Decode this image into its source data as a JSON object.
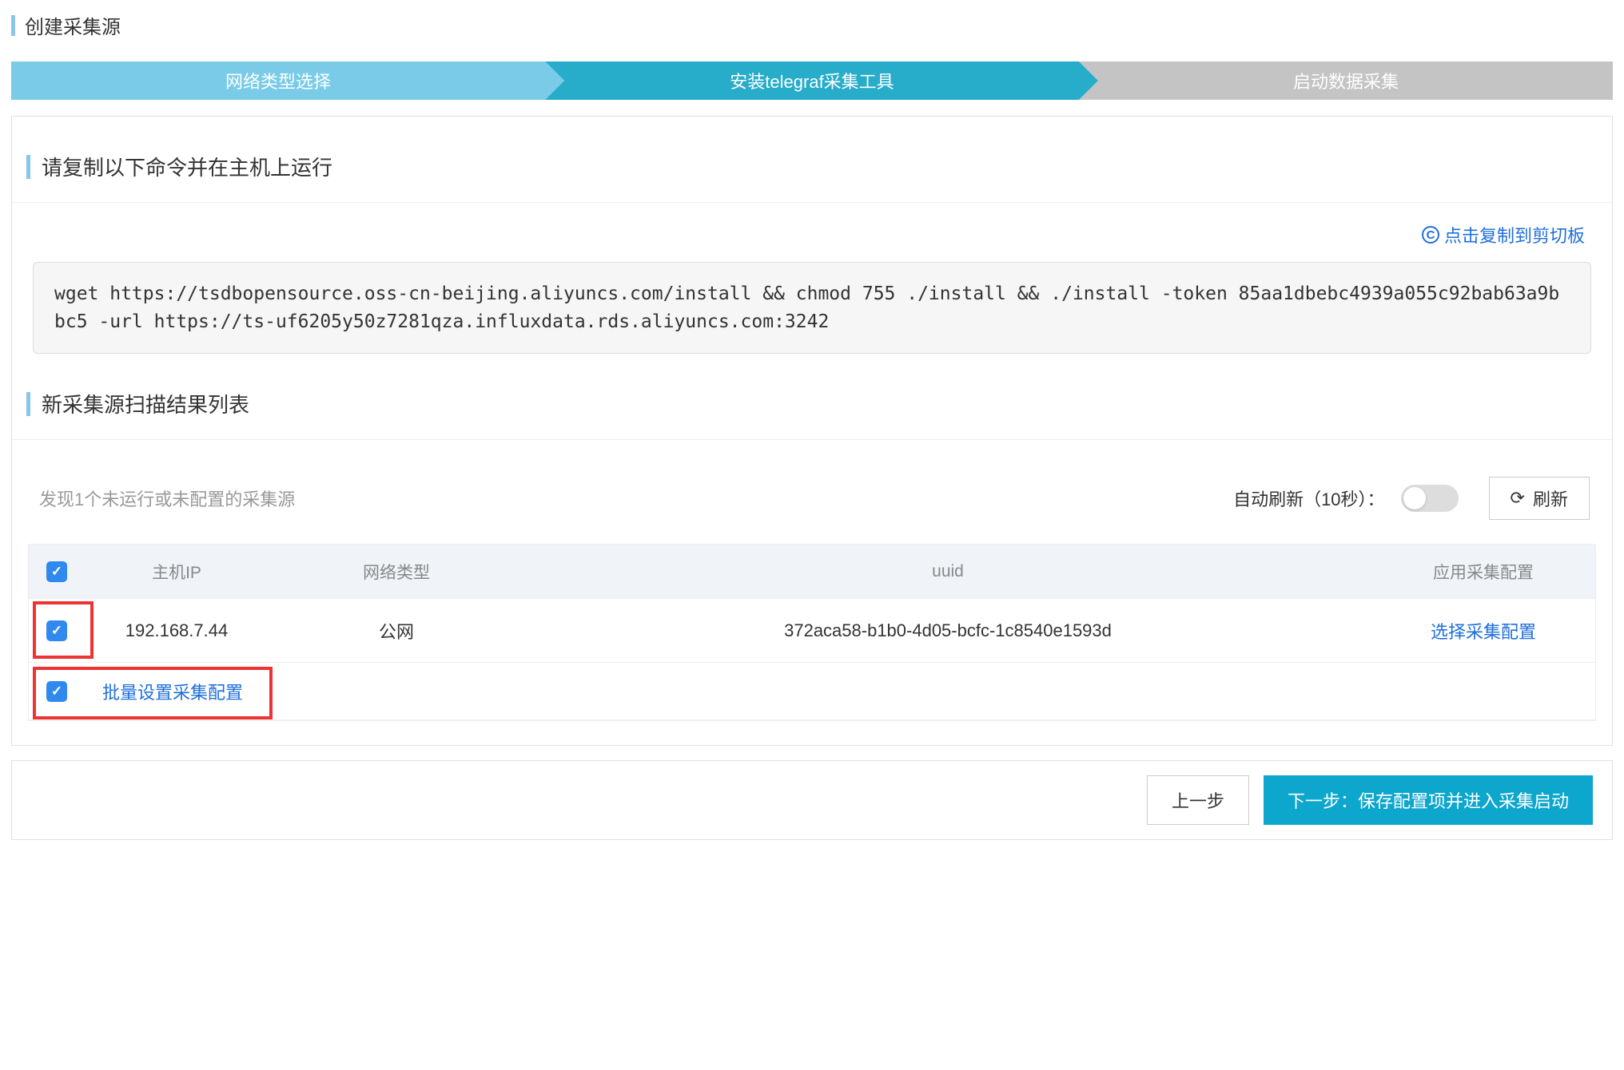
{
  "page": {
    "title": "创建采集源"
  },
  "wizard": {
    "step1": "网络类型选择",
    "step2": "安装telegraf采集工具",
    "step3": "启动数据采集"
  },
  "section1": {
    "header": "请复制以下命令并在主机上运行",
    "copy_action": "点击复制到剪切板",
    "command": "wget https://tsdbopensource.oss-cn-beijing.aliyuncs.com/install && chmod 755 ./install && ./install -token 85aa1dbebc4939a055c92bab63a9bbc5 -url https://ts-uf6205y50z7281qza.influxdata.rds.aliyuncs.com:3242"
  },
  "section2": {
    "header": "新采集源扫描结果列表",
    "subheader": "发现1个未运行或未配置的采集源",
    "auto_refresh_label": "自动刷新（10秒）：",
    "refresh_button": "刷新"
  },
  "table": {
    "headers": {
      "ip": "主机IP",
      "network": "网络类型",
      "uuid": "uuid",
      "config": "应用采集配置"
    },
    "row": {
      "ip": "192.168.7.44",
      "network": "公网",
      "uuid": "372aca58-b1b0-4d05-bcfc-1c8540e1593d",
      "select_config": "选择采集配置"
    },
    "batch_link": "批量设置采集配置"
  },
  "footer": {
    "prev": "上一步",
    "next": "下一步：保存配置项并进入采集启动"
  }
}
